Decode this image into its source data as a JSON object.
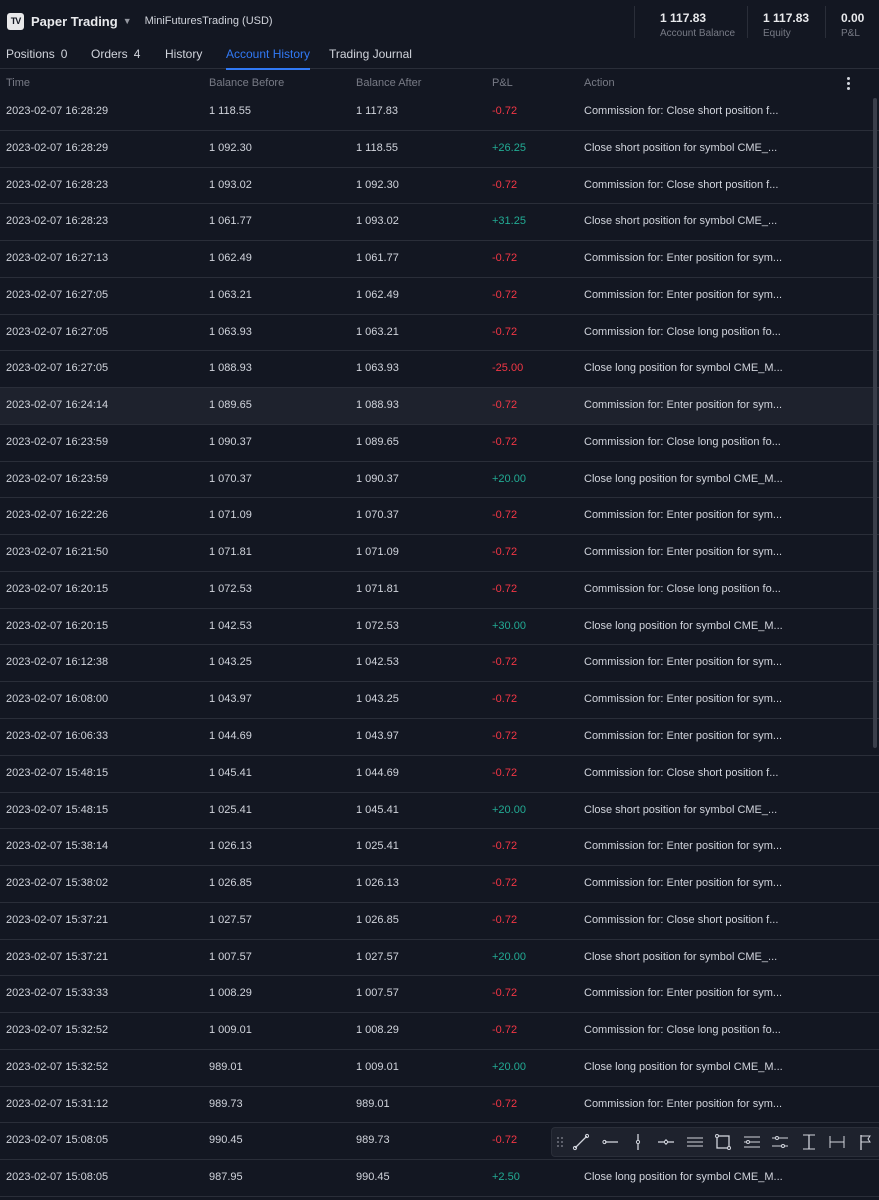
{
  "header": {
    "logo_text": "TV",
    "brand": "Paper Trading",
    "account": "MiniFuturesTrading (USD)",
    "stats": [
      {
        "value": "1 117.83",
        "label": "Account Balance"
      },
      {
        "value": "1 117.83",
        "label": "Equity"
      },
      {
        "value": "0.00",
        "label": "P&L"
      }
    ]
  },
  "tabs": [
    {
      "label": "Positions",
      "count": "0"
    },
    {
      "label": "Orders",
      "count": "4"
    },
    {
      "label": "History",
      "count": ""
    },
    {
      "label": "Account History",
      "count": ""
    },
    {
      "label": "Trading Journal",
      "count": ""
    }
  ],
  "active_tab": "Account History",
  "columns": {
    "time": "Time",
    "before": "Balance Before",
    "after": "Balance After",
    "pnl": "P&L",
    "action": "Action"
  },
  "rows": [
    {
      "time": "2023-02-07 16:28:29",
      "before": "1 118.55",
      "after": "1 117.83",
      "pnl": "-0.72",
      "action": "Commission for: Close short position f..."
    },
    {
      "time": "2023-02-07 16:28:29",
      "before": "1 092.30",
      "after": "1 118.55",
      "pnl": "+26.25",
      "action": "Close short position for symbol CME_..."
    },
    {
      "time": "2023-02-07 16:28:23",
      "before": "1 093.02",
      "after": "1 092.30",
      "pnl": "-0.72",
      "action": "Commission for: Close short position f..."
    },
    {
      "time": "2023-02-07 16:28:23",
      "before": "1 061.77",
      "after": "1 093.02",
      "pnl": "+31.25",
      "action": "Close short position for symbol CME_..."
    },
    {
      "time": "2023-02-07 16:27:13",
      "before": "1 062.49",
      "after": "1 061.77",
      "pnl": "-0.72",
      "action": "Commission for: Enter position for sym..."
    },
    {
      "time": "2023-02-07 16:27:05",
      "before": "1 063.21",
      "after": "1 062.49",
      "pnl": "-0.72",
      "action": "Commission for: Enter position for sym..."
    },
    {
      "time": "2023-02-07 16:27:05",
      "before": "1 063.93",
      "after": "1 063.21",
      "pnl": "-0.72",
      "action": "Commission for: Close long position fo..."
    },
    {
      "time": "2023-02-07 16:27:05",
      "before": "1 088.93",
      "after": "1 063.93",
      "pnl": "-25.00",
      "action": "Close long position for symbol CME_M..."
    },
    {
      "time": "2023-02-07 16:24:14",
      "before": "1 089.65",
      "after": "1 088.93",
      "pnl": "-0.72",
      "action": "Commission for: Enter position for sym..."
    },
    {
      "time": "2023-02-07 16:23:59",
      "before": "1 090.37",
      "after": "1 089.65",
      "pnl": "-0.72",
      "action": "Commission for: Close long position fo..."
    },
    {
      "time": "2023-02-07 16:23:59",
      "before": "1 070.37",
      "after": "1 090.37",
      "pnl": "+20.00",
      "action": "Close long position for symbol CME_M..."
    },
    {
      "time": "2023-02-07 16:22:26",
      "before": "1 071.09",
      "after": "1 070.37",
      "pnl": "-0.72",
      "action": "Commission for: Enter position for sym..."
    },
    {
      "time": "2023-02-07 16:21:50",
      "before": "1 071.81",
      "after": "1 071.09",
      "pnl": "-0.72",
      "action": "Commission for: Enter position for sym..."
    },
    {
      "time": "2023-02-07 16:20:15",
      "before": "1 072.53",
      "after": "1 071.81",
      "pnl": "-0.72",
      "action": "Commission for: Close long position fo..."
    },
    {
      "time": "2023-02-07 16:20:15",
      "before": "1 042.53",
      "after": "1 072.53",
      "pnl": "+30.00",
      "action": "Close long position for symbol CME_M..."
    },
    {
      "time": "2023-02-07 16:12:38",
      "before": "1 043.25",
      "after": "1 042.53",
      "pnl": "-0.72",
      "action": "Commission for: Enter position for sym..."
    },
    {
      "time": "2023-02-07 16:08:00",
      "before": "1 043.97",
      "after": "1 043.25",
      "pnl": "-0.72",
      "action": "Commission for: Enter position for sym..."
    },
    {
      "time": "2023-02-07 16:06:33",
      "before": "1 044.69",
      "after": "1 043.97",
      "pnl": "-0.72",
      "action": "Commission for: Enter position for sym..."
    },
    {
      "time": "2023-02-07 15:48:15",
      "before": "1 045.41",
      "after": "1 044.69",
      "pnl": "-0.72",
      "action": "Commission for: Close short position f..."
    },
    {
      "time": "2023-02-07 15:48:15",
      "before": "1 025.41",
      "after": "1 045.41",
      "pnl": "+20.00",
      "action": "Close short position for symbol CME_..."
    },
    {
      "time": "2023-02-07 15:38:14",
      "before": "1 026.13",
      "after": "1 025.41",
      "pnl": "-0.72",
      "action": "Commission for: Enter position for sym..."
    },
    {
      "time": "2023-02-07 15:38:02",
      "before": "1 026.85",
      "after": "1 026.13",
      "pnl": "-0.72",
      "action": "Commission for: Enter position for sym..."
    },
    {
      "time": "2023-02-07 15:37:21",
      "before": "1 027.57",
      "after": "1 026.85",
      "pnl": "-0.72",
      "action": "Commission for: Close short position f..."
    },
    {
      "time": "2023-02-07 15:37:21",
      "before": "1 007.57",
      "after": "1 027.57",
      "pnl": "+20.00",
      "action": "Close short position for symbol CME_..."
    },
    {
      "time": "2023-02-07 15:33:33",
      "before": "1 008.29",
      "after": "1 007.57",
      "pnl": "-0.72",
      "action": "Commission for: Enter position for sym..."
    },
    {
      "time": "2023-02-07 15:32:52",
      "before": "1 009.01",
      "after": "1 008.29",
      "pnl": "-0.72",
      "action": "Commission for: Close long position fo..."
    },
    {
      "time": "2023-02-07 15:32:52",
      "before": "989.01",
      "after": "1 009.01",
      "pnl": "+20.00",
      "action": "Close long position for symbol CME_M..."
    },
    {
      "time": "2023-02-07 15:31:12",
      "before": "989.73",
      "after": "989.01",
      "pnl": "-0.72",
      "action": "Commission for: Enter position for sym..."
    },
    {
      "time": "2023-02-07 15:08:05",
      "before": "990.45",
      "after": "989.73",
      "pnl": "-0.72",
      "action": ""
    },
    {
      "time": "2023-02-07 15:08:05",
      "before": "987.95",
      "after": "990.45",
      "pnl": "+2.50",
      "action": "Close long position for symbol CME_M..."
    }
  ],
  "highlighted_row": 8,
  "colors": {
    "background": "#131722",
    "accent": "#3179f5",
    "negative": "#f23645",
    "positive": "#22ab94"
  },
  "drawing_toolbar": [
    "trend-line-icon",
    "horizontal-ray-icon",
    "vertical-line-icon",
    "cross-line-icon",
    "parallel-channel-icon",
    "rectangle-icon",
    "regression-trend-icon",
    "flat-top-bottom-icon",
    "date-range-icon",
    "price-range-icon",
    "flag-icon"
  ]
}
